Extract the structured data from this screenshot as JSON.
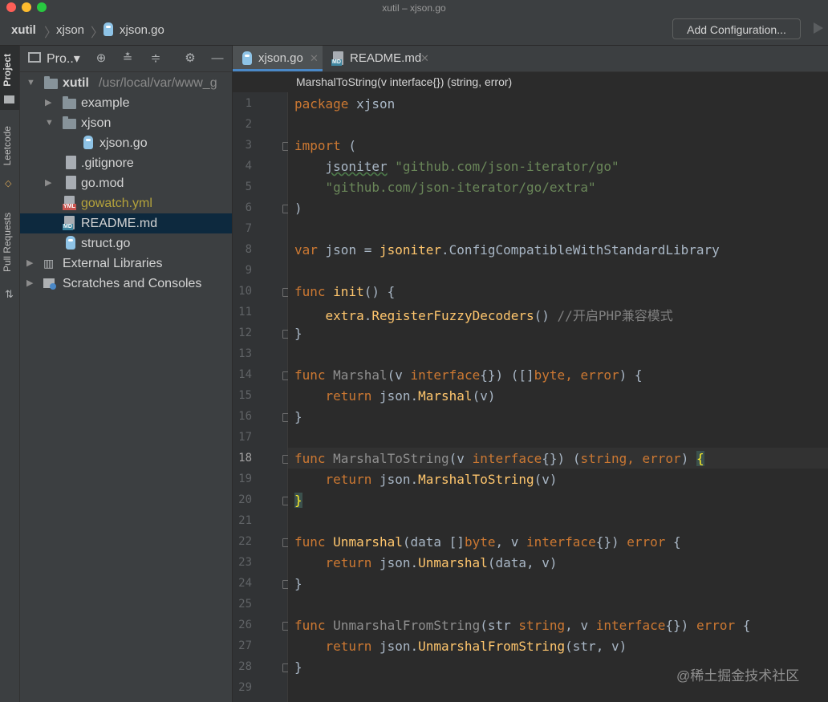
{
  "window": {
    "title": "xutil – xjson.go"
  },
  "breadcrumb": [
    "xutil",
    "xjson",
    "xjson.go"
  ],
  "toolbar": {
    "add_config_label": "Add Configuration..."
  },
  "side_tabs": [
    "Project",
    "Leetcode",
    "Pull Requests"
  ],
  "project_panel": {
    "title": "Pro..▾",
    "tree": [
      {
        "label": "xutil",
        "path": "/usr/local/var/www_g",
        "type": "folder"
      },
      {
        "label": "example",
        "type": "folder"
      },
      {
        "label": "xjson",
        "type": "folder"
      },
      {
        "label": "xjson.go",
        "type": "go"
      },
      {
        "label": ".gitignore",
        "type": "file"
      },
      {
        "label": "go.mod",
        "type": "file"
      },
      {
        "label": "gowatch.yml",
        "type": "yml"
      },
      {
        "label": "README.md",
        "type": "md"
      },
      {
        "label": "struct.go",
        "type": "go"
      },
      {
        "label": "External Libraries",
        "type": "lib"
      },
      {
        "label": "Scratches and Consoles",
        "type": "scratch"
      }
    ]
  },
  "editor": {
    "tabs": [
      {
        "label": "xjson.go"
      },
      {
        "label": "README.md"
      }
    ],
    "signature": "MarshalToString(v interface{}) (string, error)",
    "line_numbers": [
      "1",
      "2",
      "3",
      "4",
      "5",
      "6",
      "7",
      "8",
      "9",
      "10",
      "11",
      "12",
      "13",
      "14",
      "15",
      "16",
      "17",
      "18",
      "19",
      "20",
      "21",
      "22",
      "23",
      "24",
      "25",
      "26",
      "27",
      "28",
      "29"
    ],
    "current_line": "18"
  },
  "code_text": {
    "l1": [
      "package",
      " xjson"
    ],
    "l3": [
      "import",
      " ("
    ],
    "l4": [
      "    ",
      "jsoniter",
      " ",
      "\"github.com/json-iterator/go\""
    ],
    "l5": [
      "    ",
      "\"github.com/json-iterator/go/extra\""
    ],
    "l6": [
      ")"
    ],
    "l8": [
      "var",
      " json = ",
      "jsoniter",
      ".ConfigCompatibleWithStandardLibrary"
    ],
    "l10": [
      "func",
      " ",
      "init",
      "() {"
    ],
    "l11": [
      "    ",
      "extra",
      ".",
      "RegisterFuzzyDecoders",
      "() ",
      "//开启PHP兼容模式"
    ],
    "l12": [
      "}"
    ],
    "l14": [
      "func",
      " ",
      "Marshal",
      "(v ",
      "interface",
      "{}) ([]",
      "byte",
      ", ",
      "error",
      ") {"
    ],
    "l15": [
      "    ",
      "return",
      " json.",
      "Marshal",
      "(v)"
    ],
    "l16": [
      "}"
    ],
    "l18": [
      "func",
      " ",
      "MarshalToString",
      "(v ",
      "interface",
      "{}) (",
      "string",
      ", ",
      "error",
      ") ",
      "{"
    ],
    "l19": [
      "    ",
      "return",
      " json.",
      "MarshalToString",
      "(v)"
    ],
    "l20": [
      "}"
    ],
    "l22": [
      "func",
      " ",
      "Unmarshal",
      "(data []",
      "byte",
      ", v ",
      "interface",
      "{}) ",
      "error",
      " {"
    ],
    "l23": [
      "    ",
      "return",
      " json.",
      "Unmarshal",
      "(data, v)"
    ],
    "l24": [
      "}"
    ],
    "l26": [
      "func",
      " ",
      "UnmarshalFromString",
      "(str ",
      "string",
      ", v ",
      "interface",
      "{}) ",
      "error",
      " {"
    ],
    "l27": [
      "    ",
      "return",
      " json.",
      "UnmarshalFromString",
      "(str, v)"
    ],
    "l28": [
      "}"
    ]
  },
  "watermark": "@稀土掘金技术社区",
  "colors": {
    "keyword": "#cc7832",
    "function": "#ffc66d",
    "string": "#6a8759",
    "comment": "#808080",
    "selection": "#0d293e",
    "tab_underline": "#4a88c7"
  }
}
